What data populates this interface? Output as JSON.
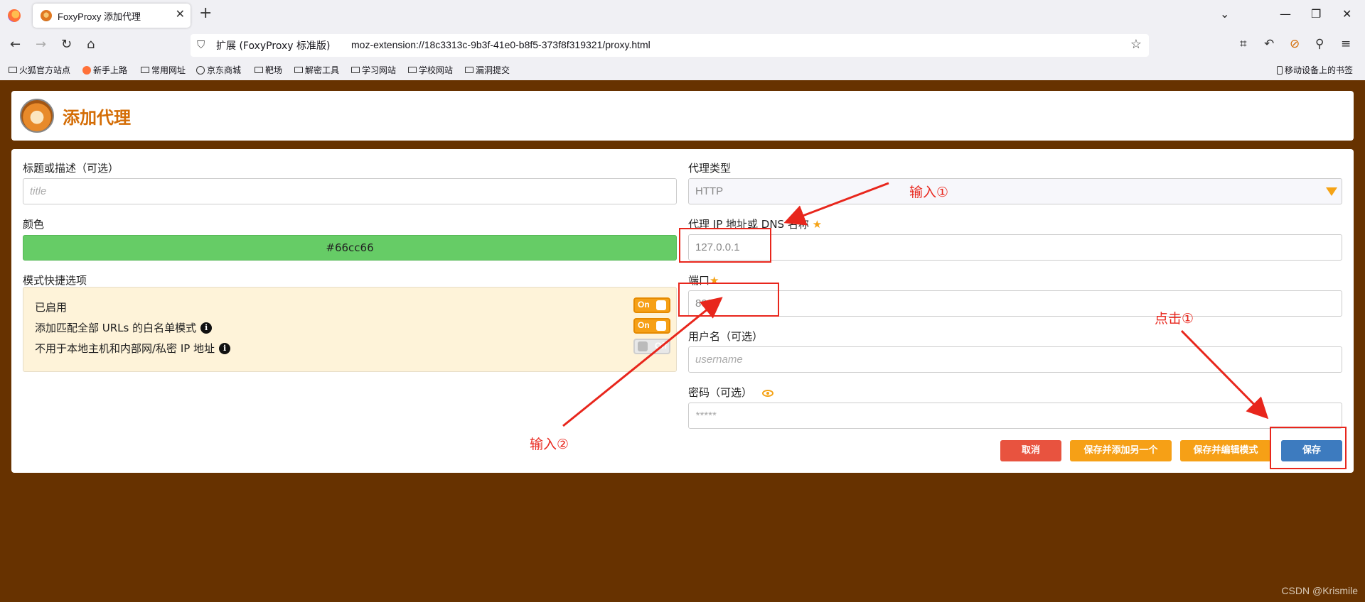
{
  "browser": {
    "tab_title": "FoxyProxy 添加代理",
    "url_extension_label": "扩展 (FoxyProxy 标准版)",
    "url": "moz-extension://18c3313c-9b3f-41e0-b8f5-373f8f319321/proxy.html",
    "bookmarks": [
      "火狐官方站点",
      "新手上路",
      "常用网址",
      "京东商城",
      "靶场",
      "解密工具",
      "学习网站",
      "学校网站",
      "漏洞提交"
    ],
    "mobile_bookmarks": "移动设备上的书签"
  },
  "header": {
    "title": "添加代理"
  },
  "form": {
    "title_label": "标题或描述（可选）",
    "title_placeholder": "title",
    "color_label": "颜色",
    "color_value": "#66cc66",
    "pattern_label": "模式快捷选项",
    "patterns": [
      {
        "label": "已启用",
        "state": "On",
        "info": false
      },
      {
        "label": "添加匹配全部 URLs 的白名单模式",
        "state": "On",
        "info": true
      },
      {
        "label": "不用于本地主机和内部网/私密 IP 地址",
        "state": "Off",
        "info": true
      }
    ],
    "proxy_type_label": "代理类型",
    "proxy_type_value": "HTTP",
    "ip_label": "代理 IP 地址或 DNS 名称",
    "ip_value": "127.0.0.1",
    "port_label": "端口",
    "port_value": "8080",
    "username_label": "用户名（可选）",
    "username_placeholder": "username",
    "password_label": "密码（可选）",
    "password_placeholder": "*****"
  },
  "buttons": {
    "cancel": "取消",
    "save_add_another": "保存并添加另一个",
    "save_edit_patterns": "保存并编辑模式",
    "save": "保存"
  },
  "annotations": {
    "input1": "输入①",
    "input2": "输入②",
    "click1": "点击①"
  },
  "watermark": "CSDN @Krismile",
  "colors": {
    "page_background": "#673200",
    "accent_orange": "#f6a016",
    "title_orange": "#d46d06",
    "save_blue": "#3d7bbf",
    "cancel_red": "#e8533f",
    "annotation_red": "#e8261c"
  }
}
